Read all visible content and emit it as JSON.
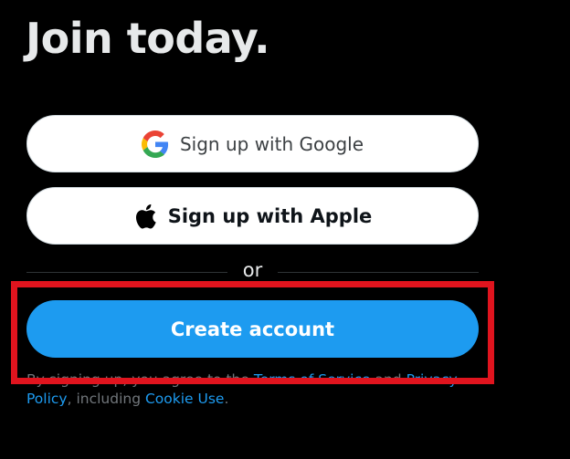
{
  "header": {
    "title": "Join today."
  },
  "buttons": {
    "google_label": "Sign up with Google",
    "apple_label": "Sign up with Apple",
    "create_label": "Create account"
  },
  "divider": {
    "text": "or"
  },
  "legal": {
    "prefix": "By signing up, you agree to the ",
    "terms_link": "Terms of Service",
    "and_text": " and ",
    "privacy_link": "Privacy Policy",
    "including_text": ", including ",
    "cookie_link": "Cookie Use",
    "suffix": "."
  },
  "icons": {
    "google": "google-icon",
    "apple": "apple-icon"
  },
  "colors": {
    "background": "#000000",
    "primary_blue": "#1d9bf0",
    "highlight_red": "#e0141e",
    "button_white": "#ffffff"
  }
}
